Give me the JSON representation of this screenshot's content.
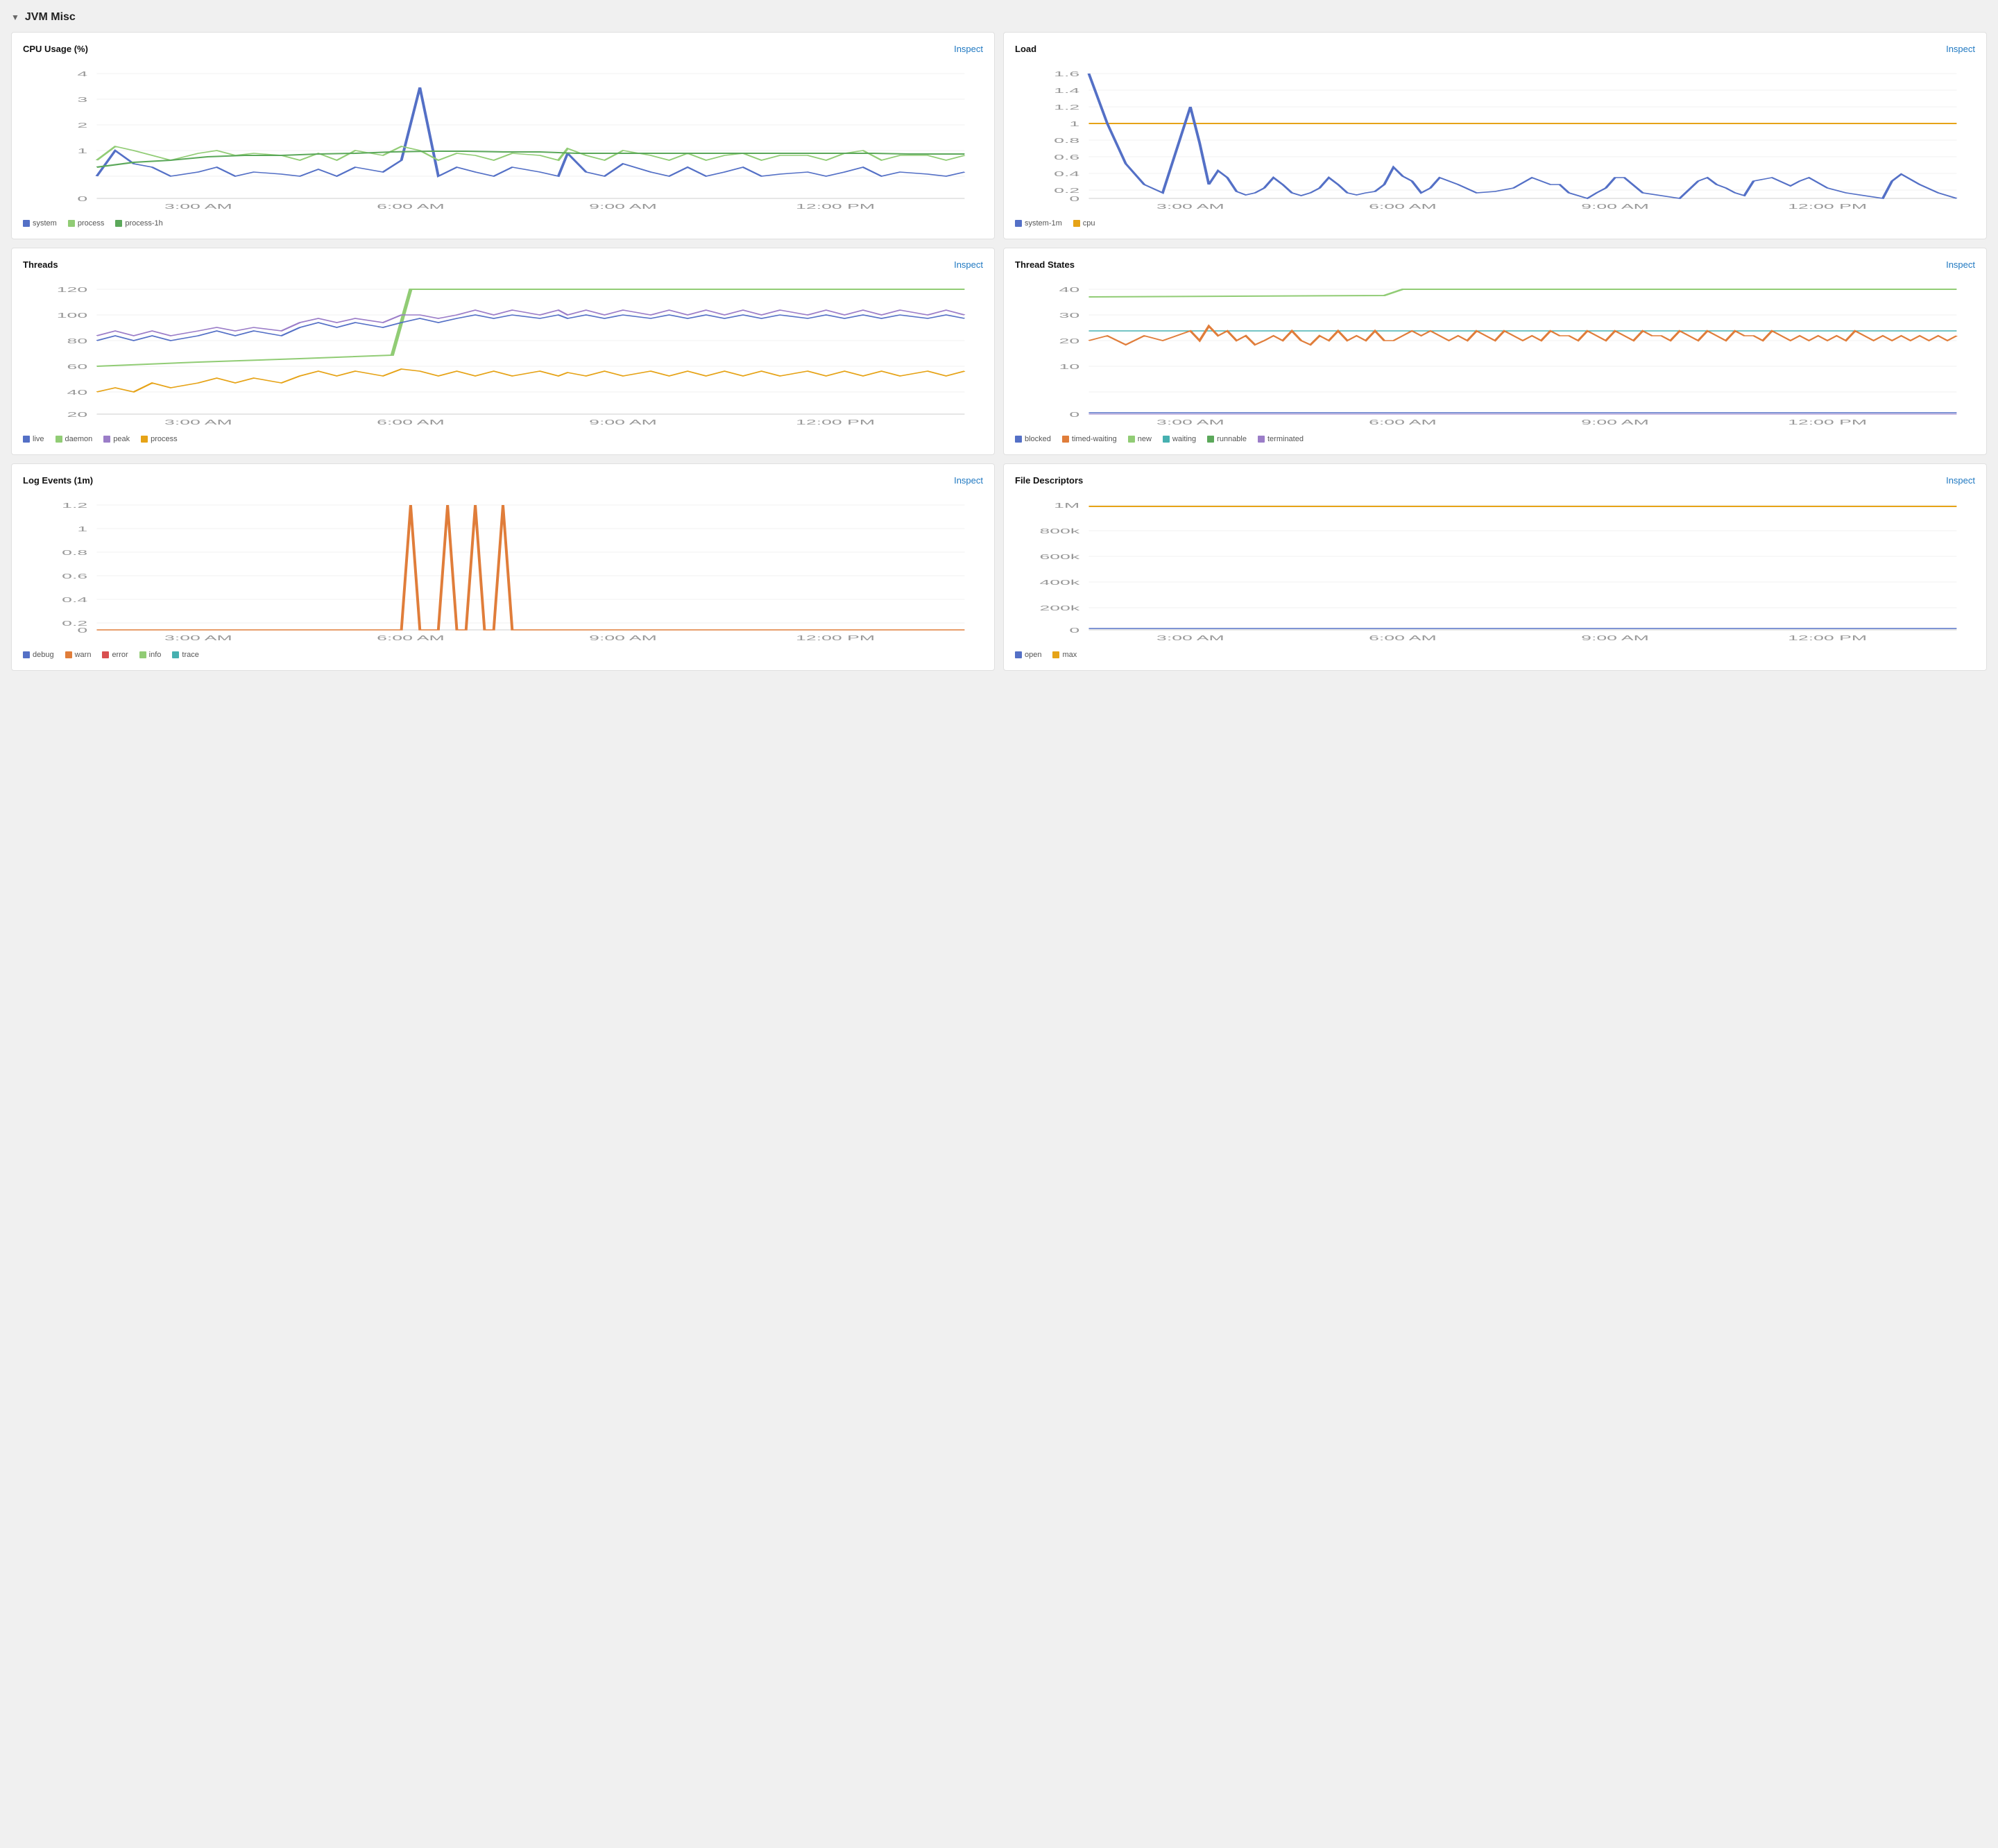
{
  "section": {
    "title": "JVM Misc",
    "chevron": "▼"
  },
  "cards": [
    {
      "id": "cpu-usage",
      "title": "CPU Usage (%)",
      "inspect_label": "Inspect",
      "legend": [
        {
          "label": "system",
          "color": "#5470c6"
        },
        {
          "label": "process",
          "color": "#91cc75"
        },
        {
          "label": "process-1h",
          "color": "#5ba85a"
        }
      ]
    },
    {
      "id": "load",
      "title": "Load",
      "inspect_label": "Inspect",
      "legend": [
        {
          "label": "system-1m",
          "color": "#5470c6"
        },
        {
          "label": "cpu",
          "color": "#e6a317"
        }
      ]
    },
    {
      "id": "threads",
      "title": "Threads",
      "inspect_label": "Inspect",
      "legend": [
        {
          "label": "live",
          "color": "#5470c6"
        },
        {
          "label": "daemon",
          "color": "#91cc75"
        },
        {
          "label": "peak",
          "color": "#9b7dc8"
        },
        {
          "label": "process",
          "color": "#e6a317"
        }
      ]
    },
    {
      "id": "thread-states",
      "title": "Thread States",
      "inspect_label": "Inspect",
      "legend": [
        {
          "label": "blocked",
          "color": "#5470c6"
        },
        {
          "label": "timed-waiting",
          "color": "#e07d3a"
        },
        {
          "label": "new",
          "color": "#91cc75"
        },
        {
          "label": "waiting",
          "color": "#46b0b0"
        },
        {
          "label": "runnable",
          "color": "#5ba85a"
        },
        {
          "label": "terminated",
          "color": "#9b7dc8"
        }
      ]
    },
    {
      "id": "log-events",
      "title": "Log Events (1m)",
      "inspect_label": "Inspect",
      "legend": [
        {
          "label": "debug",
          "color": "#5470c6"
        },
        {
          "label": "warn",
          "color": "#e07d3a"
        },
        {
          "label": "error",
          "color": "#d94f4f"
        },
        {
          "label": "info",
          "color": "#91cc75"
        },
        {
          "label": "trace",
          "color": "#46b0b0"
        }
      ]
    },
    {
      "id": "file-descriptors",
      "title": "File Descriptors",
      "inspect_label": "Inspect",
      "legend": [
        {
          "label": "open",
          "color": "#5470c6"
        },
        {
          "label": "max",
          "color": "#e6a317"
        }
      ]
    }
  ]
}
